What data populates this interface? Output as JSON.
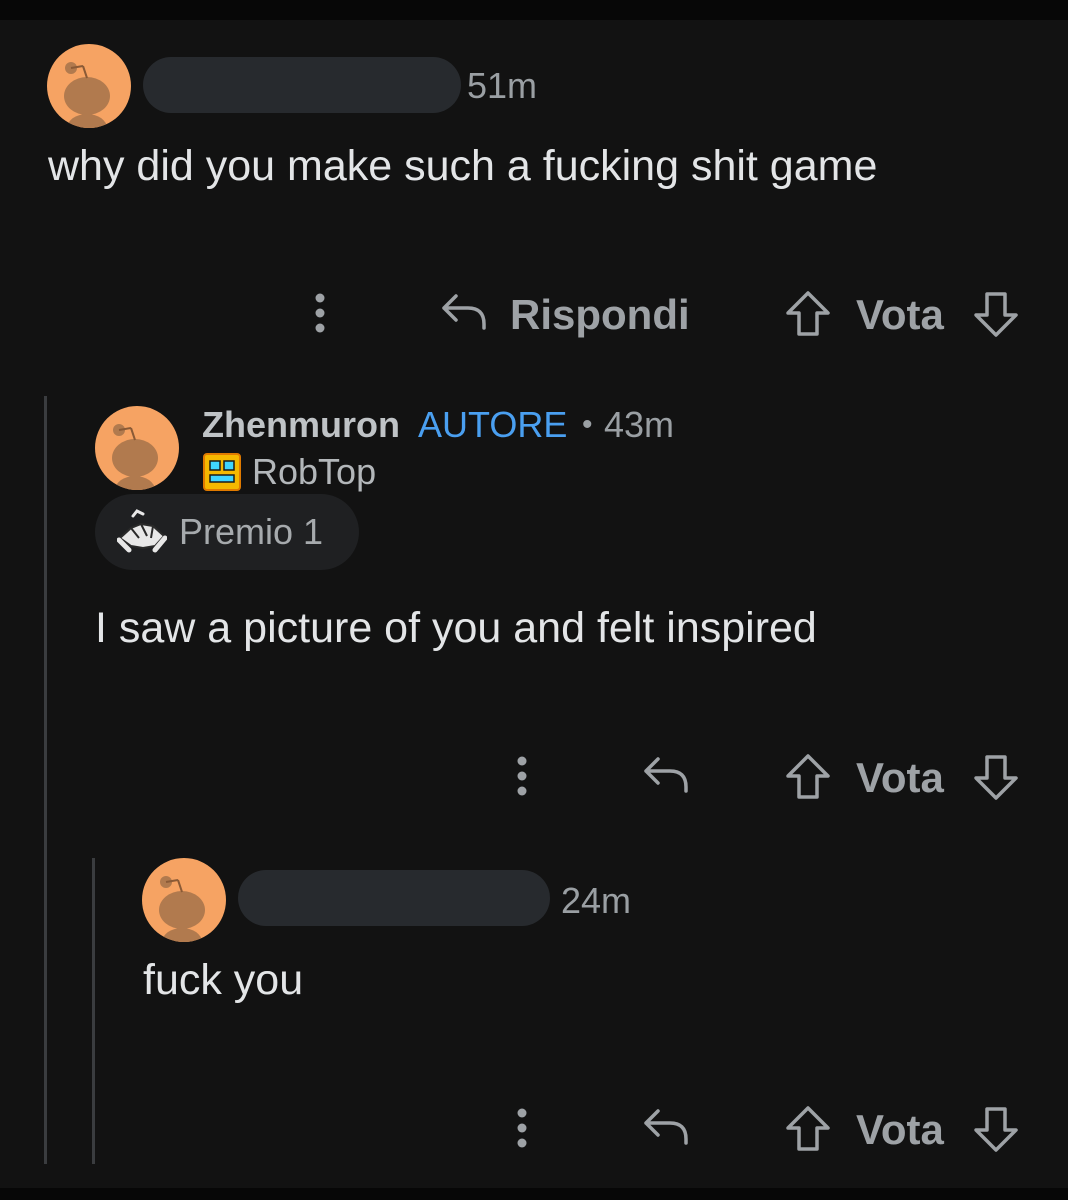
{
  "comments": [
    {
      "time": "51m",
      "body": "why did you make such a fucking shit game",
      "actions": {
        "reply_label": "Rispondi",
        "vote_label": "Vota"
      }
    },
    {
      "username": "Zhenmuron",
      "op_badge": "AUTORE",
      "separator": "•",
      "time": "43m",
      "flair": "RobTop",
      "award": "Premio 1",
      "body": "I saw a picture of you and felt inspired",
      "actions": {
        "vote_label": "Vota"
      }
    },
    {
      "time": "24m",
      "body": "fuck you",
      "actions": {
        "vote_label": "Vota"
      }
    }
  ],
  "colors": {
    "background": "#121212",
    "op_badge": "#4a9ff0",
    "avatar": "#f6a363",
    "flair_icon": "#f5b800"
  },
  "icons": {
    "more": "more-vertical-icon",
    "reply": "reply-arrow-icon",
    "upvote": "upvote-arrow-icon",
    "downvote": "downvote-arrow-icon",
    "award": "handshake-award-icon",
    "flair": "geometry-dash-cube-icon"
  }
}
